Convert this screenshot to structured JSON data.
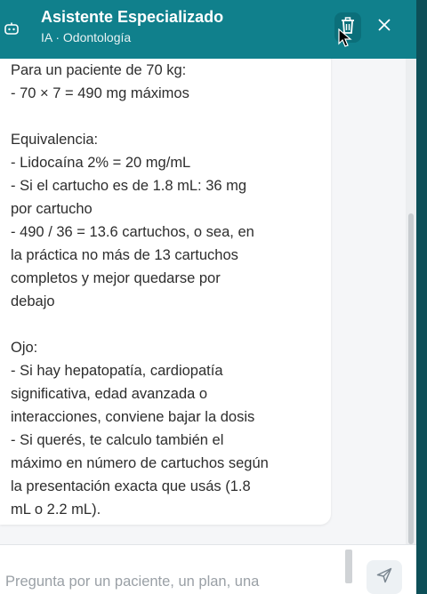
{
  "header": {
    "title": "Asistente Especializado",
    "subtitle": "IA · Odontología",
    "bot_icon": "robot-icon",
    "trash_icon": "trash-icon",
    "close_icon": "close-icon",
    "background": "#10808c"
  },
  "message": {
    "lines": [
      "Para un paciente de 70 kg:",
      "- 70 × 7 = 490 mg máximos",
      "",
      "Equivalencia:",
      "- Lidocaína 2% = 20 mg/mL",
      "- Si el cartucho es de 1.8 mL: 36 mg",
      "por cartucho",
      "- 490 / 36 = 13.6 cartuchos, o sea, en",
      "la práctica no más de 13 cartuchos",
      "completos y mejor quedarse por",
      "debajo",
      "",
      "Ojo:",
      "- Si hay hepatopatía, cardiopatía",
      "significativa, edad avanzada o",
      "interacciones, conviene bajar la dosis",
      "- Si querés, te calculo también el",
      "máximo en número de cartuchos según",
      "la presentación exacta que usás (1.8",
      "mL o 2.2 mL)."
    ]
  },
  "composer": {
    "placeholder": "Pregunta por un paciente, un plan, una",
    "send_icon": "send-icon"
  }
}
